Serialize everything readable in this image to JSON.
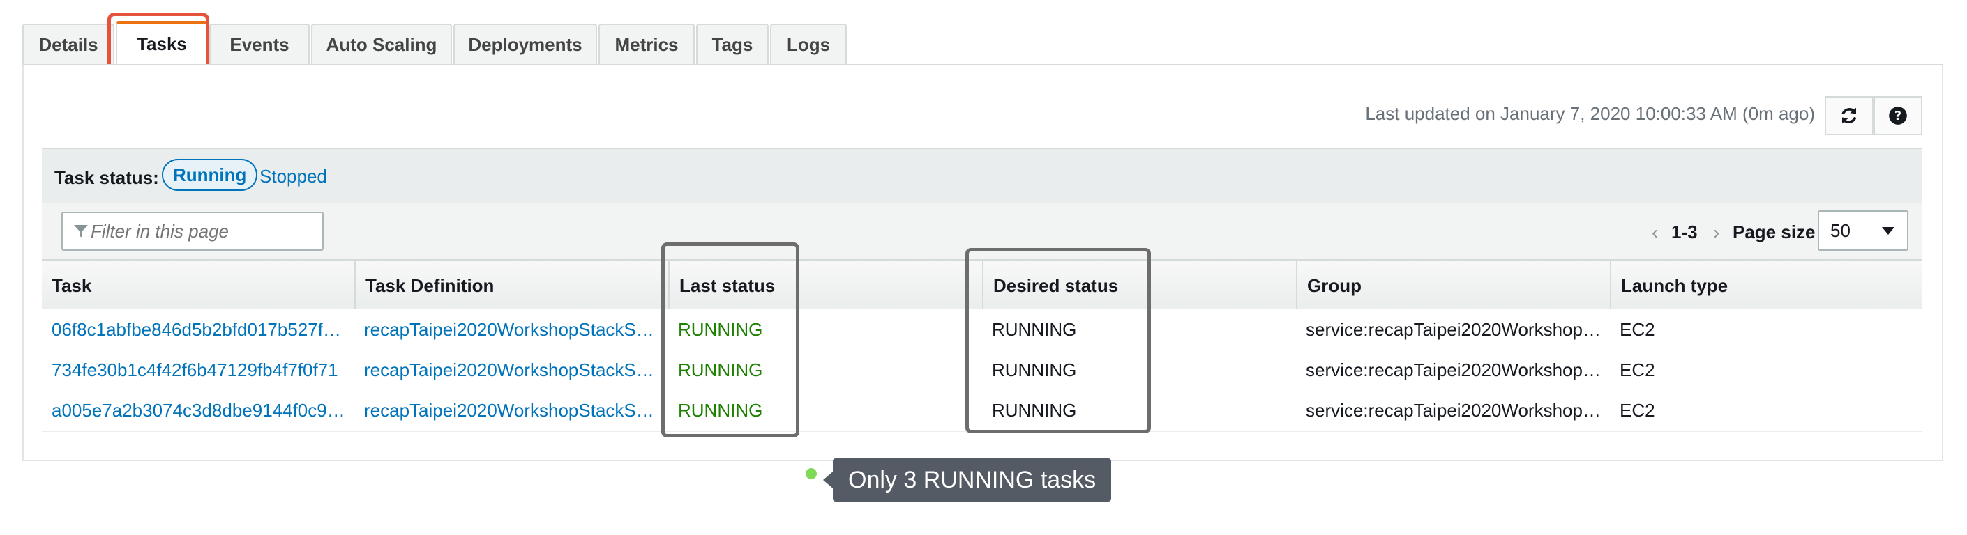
{
  "tabs": [
    {
      "label": "Details",
      "active": false
    },
    {
      "label": "Tasks",
      "active": true
    },
    {
      "label": "Events",
      "active": false
    },
    {
      "label": "Auto Scaling",
      "active": false
    },
    {
      "label": "Deployments",
      "active": false
    },
    {
      "label": "Metrics",
      "active": false
    },
    {
      "label": "Tags",
      "active": false
    },
    {
      "label": "Logs",
      "active": false
    }
  ],
  "toolbar": {
    "last_updated": "Last updated on January 7, 2020 10:00:33 AM (0m ago)",
    "refresh_icon": "refresh-icon",
    "help_icon": "help-icon"
  },
  "task_status": {
    "label": "Task status:",
    "selected": "Running",
    "other": "Stopped"
  },
  "filter": {
    "placeholder": "Filter in this page"
  },
  "pagination": {
    "prev": "‹",
    "range": "1-3",
    "next": "›",
    "page_size_label": "Page size",
    "page_size": "50"
  },
  "table": {
    "columns": [
      "Task",
      "Task Definition",
      "Last status",
      "Desired status",
      "Group",
      "Launch type"
    ],
    "rows": [
      {
        "task": "06f8c1abfbe846d5b2bfd017b527f…",
        "task_definition": "recapTaipei2020WorkshopStackS…",
        "last_status": "RUNNING",
        "desired_status": "RUNNING",
        "group": "service:recapTaipei2020Workshop…",
        "launch_type": "EC2"
      },
      {
        "task": "734fe30b1c4f42f6b47129fb4f7f0f71",
        "task_definition": "recapTaipei2020WorkshopStackS…",
        "last_status": "RUNNING",
        "desired_status": "RUNNING",
        "group": "service:recapTaipei2020Workshop…",
        "launch_type": "EC2"
      },
      {
        "task": "a005e7a2b3074c3d8dbe9144f0c9…",
        "task_definition": "recapTaipei2020WorkshopStackS…",
        "last_status": "RUNNING",
        "desired_status": "RUNNING",
        "group": "service:recapTaipei2020Workshop…",
        "launch_type": "EC2"
      }
    ]
  },
  "annotation": {
    "text": "Only 3 RUNNING tasks"
  },
  "colors": {
    "link": "#0073bb",
    "running": "#1d8102",
    "tab_highlight": "#e5533d",
    "annotation_box": "#6d6d6d",
    "tooltip_bg": "#545b64",
    "dot": "#7ed957"
  }
}
